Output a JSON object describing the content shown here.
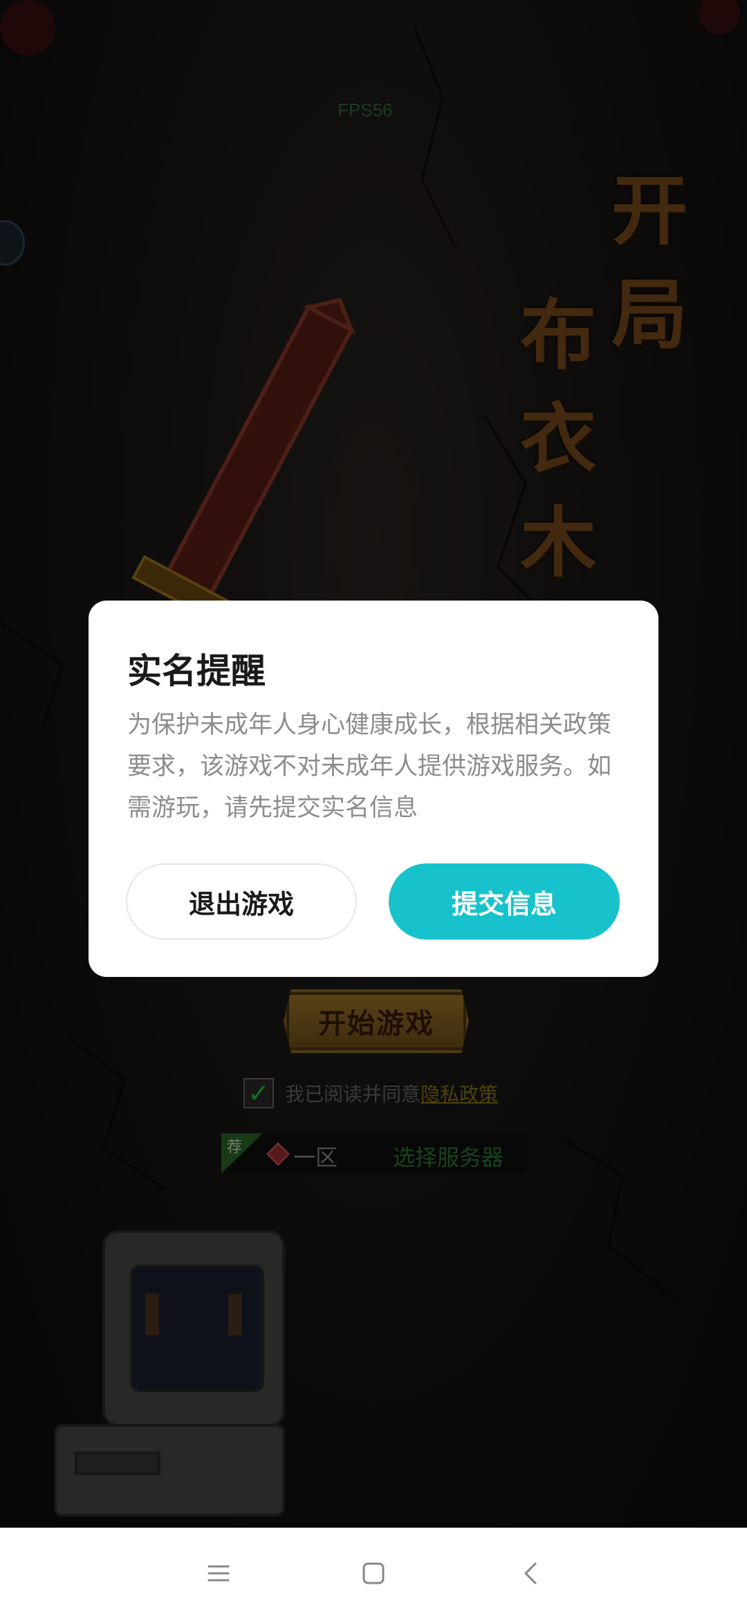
{
  "game": {
    "fps_label": "FPS56",
    "title_col1": "开局",
    "title_col2": "布衣木剑",
    "start_button": "开始游戏",
    "agree_text": "我已阅读并同意",
    "privacy_link": "隐私政策",
    "server": {
      "tag": "荐",
      "name": "一区",
      "select_label": "选择服务器"
    }
  },
  "dialog": {
    "title": "实名提醒",
    "body": "为保护未成年人身心健康成长，根据相关政策要求，该游戏不对未成年人提供游戏服务。如需游玩，请先提交实名信息",
    "exit_button": "退出游戏",
    "submit_button": "提交信息"
  },
  "colors": {
    "accent": "#17c2cc",
    "dialog_bg": "#ffffff",
    "body_text": "#8c8c8c"
  },
  "icons": {
    "nav_menu": "menu-icon",
    "nav_home": "home-icon",
    "nav_back": "back-icon",
    "checkbox": "checkmark-icon"
  }
}
